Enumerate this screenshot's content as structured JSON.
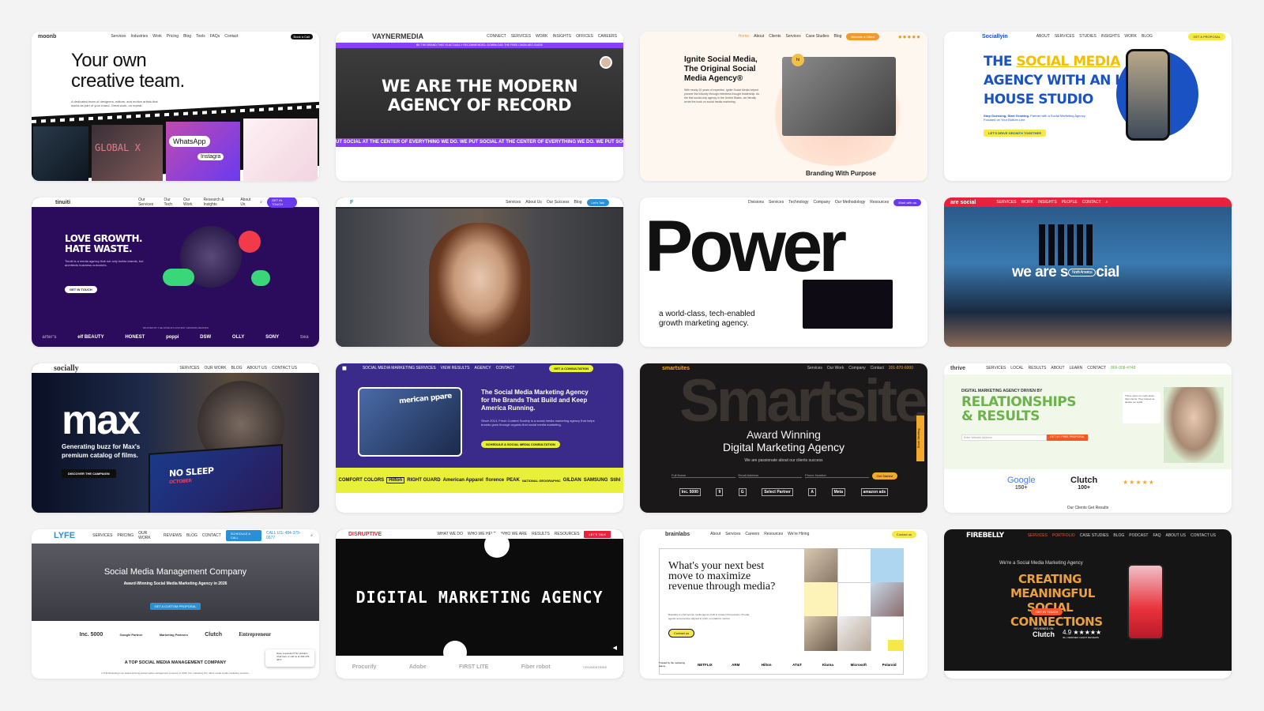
{
  "cards": {
    "moonb": {
      "logo": "moonb",
      "nav": [
        "Services",
        "Industries",
        "Work",
        "Pricing",
        "Blog",
        "Tools",
        "FAQs",
        "Contact"
      ],
      "cta": "Book a Call",
      "headline1": "Your own",
      "headline2": "creative team.",
      "sub": "A dedicated team of designers, editors, and motion artists that works as part of your brand. Great work, on repeat.",
      "tile1": "GLOBAL X",
      "tile2": "WhatsApp",
      "tile3": "Instagra"
    },
    "vayner": {
      "logo": "VAYNERMEDIA",
      "nav": [
        "CONNECT",
        "SERVICES",
        "WORK",
        "INSIGHTS",
        "OFFICES",
        "CAREERS"
      ],
      "banner": "BE THE BRAND THAT IS ACTUALLY RECOMMENDED. DOWNLOAD THE FREE CMOS AEO GUIDE",
      "headline1": "WE ARE THE MODERN",
      "headline2": "AGENCY OF RECORD",
      "ticker": "UT SOCIAL AT THE CENTER OF EVERYTHING WE DO. WE PUT SOCIAL AT THE CENTER OF EVERYTHING WE DO. WE PUT SOC"
    },
    "ignite": {
      "nav": [
        "Home",
        "About",
        "Clients",
        "Services",
        "Case Studies",
        "Blog"
      ],
      "cta": "Become a Client",
      "headline": "Ignite Social Media, The Original Social Media Agency®",
      "body": "With nearly 20 years of expertise, Ignite Social Media helped pioneer the industry through relentless thought leadership. As the first social-only agency in the United States, we literally wrote the book on social media marketing.",
      "footer": "Branding With Purpose",
      "badge": "hi"
    },
    "socially_in": {
      "logo": "Sociallyin",
      "nav": [
        "ABOUT",
        "SERVICES",
        "STUDIES",
        "INSIGHTS",
        "WORK",
        "BLOG"
      ],
      "cta": "GET A PROPOSAL",
      "headline1": "THE",
      "headline_accent": "SOCIAL MEDIA",
      "headline2": "AGENCY WITH AN IN-",
      "headline3": "HOUSE STUDIO",
      "sub_bold": "Stop Guessing, Start Growing.",
      "sub": "Partner with a Social Marketing Agency Focused on Your Bottom Line",
      "button": "LET'S DRIVE GROWTH TOGETHER"
    },
    "tinuiti": {
      "logo": "tinuiti",
      "nav": [
        "Our Services",
        "Our Tech",
        "Our Work",
        "Research & Insights",
        "About Us"
      ],
      "cta": "GET IN TOUCH",
      "headline1": "LOVE GROWTH.",
      "headline2": "HATE WASTE.",
      "body": "Tinuiti is a media agency that not only builds brands, but architects business outcomes.",
      "button": "GET IN TOUCH",
      "trusted": "TRUSTED BY THE WORLD'S FASTEST GROWING BRANDS",
      "brands": [
        "arter's",
        "elf BEAUTY",
        "HONEST",
        "poppi",
        "DSW",
        "OLLY",
        "SONY",
        "Sea"
      ]
    },
    "video_agency": {
      "logo": "F",
      "nav": [
        "Services",
        "About Us",
        "Our Success",
        "Blog"
      ],
      "cta": "Let's Talk"
    },
    "power": {
      "nav": [
        "Divisions",
        "Services",
        "Technology",
        "Company",
        "Our Methodology",
        "Resources"
      ],
      "cta": "Work with us",
      "headline": "Power",
      "sub1": "a world-class, tech-enabled",
      "sub2": "growth marketing agency."
    },
    "we_are_social": {
      "logo": "are social",
      "nav": [
        "SERVICES",
        "WORK",
        "INSIGHTS",
        "PEOPLE",
        "CONTACT"
      ],
      "headline_left": "we are s",
      "badge": "North America",
      "headline_right": "cial"
    },
    "socially": {
      "logo": "socially",
      "nav": [
        "SERVICES",
        "OUR WORK",
        "BLOG",
        "ABOUT US",
        "CONTACT US"
      ],
      "headline": "max",
      "sub1": "Generating buzz for Max's",
      "sub2": "premium catalog of films.",
      "button": "DISCOVER THE CAMPAIGN",
      "overlay1": "NO SLEEP",
      "overlay2": "OCTOBER"
    },
    "fresh_content": {
      "nav": [
        "SOCIAL MEDIA MARKETING SERVICES",
        "VIEW RESULTS",
        "AGENCY",
        "CONTACT"
      ],
      "cta": "GET A CONSULTATION",
      "headline": "The Social Media Marketing Agency for the Brands That Build and Keep America Running.",
      "body": "Since 2014, Fresh Content Society is a social media marketing agency that helps brands grow through organic-first social media marketing.",
      "button": "SCHEDULE A SOCIAL MEDIA CONSULTATION",
      "thumb": "merican ppare",
      "brands": [
        "COMFORT COLORS",
        "Hilton",
        "RIGHT GUARD",
        "American Apparel",
        "florence",
        "PEAK",
        "NATIONAL GEOGRAPHIC",
        "GILDAN",
        "SAMSUNG",
        "Stihl"
      ]
    },
    "smartsites": {
      "logo": "smartsites",
      "nav": [
        "Services",
        "Our Work",
        "Company",
        "Contact"
      ],
      "phone": "201-870-6000",
      "bg": "Smartsites",
      "headline1": "Award Winning",
      "headline2": "Digital Marketing Agency",
      "sub": "We are passionate about our clients success",
      "fields": [
        "Full Name",
        "Email Address",
        "Phone Number"
      ],
      "button": "Get Started",
      "side": "Book Meeting",
      "badges": [
        "Inc. 5000",
        "9",
        "G",
        "Select Partner",
        "A",
        "Meta",
        "amazon ads"
      ]
    },
    "thrive": {
      "logo": "thrive",
      "nav": [
        "SERVICES",
        "LOCAL",
        "RESULTS",
        "ABOUT",
        "LEARN",
        "CONTACT"
      ],
      "phone": "866-908-4748",
      "eyebrow": "DIGITAL MARKETING AGENCY DRIVEN BY",
      "headline1": "RELATIONSHIPS",
      "headline2": "& RESULTS",
      "input": "Enter Website Address",
      "button": "GET MY FREE PROPOSAL",
      "google": "Google",
      "google_count": "150+",
      "clutch": "Clutch",
      "clutch_count": "100+",
      "footer": "Our Clients Get Results",
      "quote": "Thrive cares so much about their clients. They helped us double our leads."
    },
    "lyfe": {
      "logo": "LYFE",
      "nav": [
        "SERVICES",
        "PRICING",
        "OUR WORK",
        "REVIEWS",
        "BLOG",
        "CONTACT"
      ],
      "cta": "SCHEDULE A CALL",
      "phone": "CALL US: 484-379-0677",
      "headline": "Social Media Management Company",
      "sub": "Award-Winning Social Media Marketing Agency in 2026",
      "button": "GET A CUSTOM PROPOSAL",
      "badges": [
        "Inc. 5000",
        "Google Partner",
        "Marketing Partners",
        "Clutch",
        "Entrepreneur"
      ],
      "footer": "A TOP SOCIAL MEDIA MANAGEMENT COMPANY",
      "footer_sub": "LYFE Marketing is an award-winning social media management company in 2026. Our marketing firm offers social media marketing services.",
      "chat": "Have a question? No problem. Chat here or call us at 404-479-4677"
    },
    "disruptive": {
      "logo": "DISRUPTIVE",
      "nav": [
        "WHAT WE DO",
        "WHO WE HELP",
        "WHO WE ARE",
        "RESULTS",
        "RESOURCES"
      ],
      "cta": "LET'S TALK",
      "headline": "DIGITAL MARKETING AGENCY",
      "brands": [
        "Procurify",
        "Adobe",
        "FIRST LITE",
        "Fiber robot",
        "CROWDSTRIKE"
      ]
    },
    "brainlabs": {
      "logo": "brainlabs",
      "nav": [
        "About",
        "Services",
        "Careers",
        "Resources",
        "We're Hiring"
      ],
      "cta": "Contact us",
      "headline": "What's your next best move to maximize revenue through media?",
      "body": "Brainlabs is a full service media agency built to answer that question. Proudly agentic and precision aligned to profit, not platform metrics.",
      "button": "Contact us",
      "trusted": "Trusted by the marketing teams",
      "brands": [
        "NETFLIX",
        "ARM",
        "Hilton",
        "AT&T",
        "Klarna",
        "Microsoft",
        "Polaroid"
      ]
    },
    "firebelly": {
      "logo": "FIREBELLY",
      "nav": [
        "SERVICES",
        "PORTFOLIO",
        "CASE STUDIES",
        "BLOG",
        "PODCAST",
        "FAQ",
        "ABOUT US",
        "CONTACT US"
      ],
      "eyebrow": "We're a Social Media Marketing Agency",
      "headline1": "CREATING MEANINGFUL",
      "headline2": "SOCIAL CONNECTIONS",
      "button": "GET IN TOUCH",
      "reviewed": "REVIEWED ON",
      "clutch": "Clutch",
      "rating": "4.9 ★★★★★",
      "reviews": "30+ VERIFIED CLIENT REVIEWS"
    }
  },
  "colors": {
    "page_bg": "#f4f3f3",
    "vayner_purple": "#8a3ffc",
    "tinuiti_purple": "#2a0b5c",
    "fresh_purple": "#3a2a8a",
    "fresh_yellow": "#e8f03a",
    "social_red": "#e8223a",
    "thrive_green": "#6bb34a",
    "lyfe_blue": "#2a8fd6",
    "firebelly_orange": "#f2562b",
    "sociallyin_blue": "#1a52c4"
  }
}
